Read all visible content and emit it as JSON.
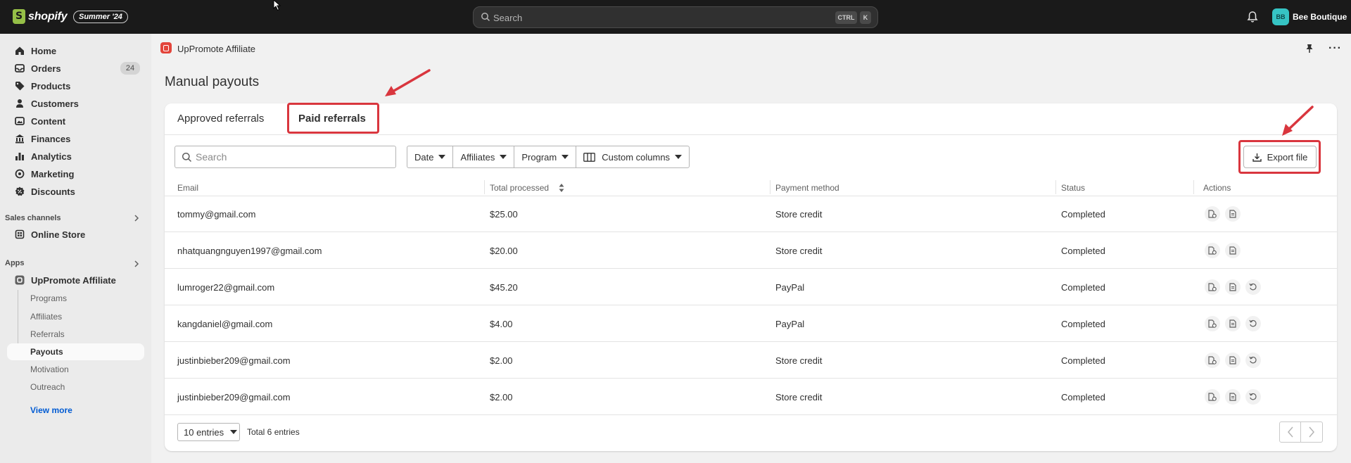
{
  "topbar": {
    "logo_text": "shopify",
    "edition": "Summer '24",
    "search_placeholder": "Search",
    "kbd_ctrl": "CTRL",
    "kbd_k": "K",
    "avatar_initials": "BB",
    "store_name": "Bee Boutique"
  },
  "sidebar": {
    "items": [
      {
        "label": "Home",
        "icon": "home-icon"
      },
      {
        "label": "Orders",
        "icon": "inbox-icon",
        "badge": "24"
      },
      {
        "label": "Products",
        "icon": "tag-icon"
      },
      {
        "label": "Customers",
        "icon": "person-icon"
      },
      {
        "label": "Content",
        "icon": "image-icon"
      },
      {
        "label": "Finances",
        "icon": "bank-icon"
      },
      {
        "label": "Analytics",
        "icon": "bar-chart-icon"
      },
      {
        "label": "Marketing",
        "icon": "target-icon"
      },
      {
        "label": "Discounts",
        "icon": "discount-icon"
      }
    ],
    "sales_channels_title": "Sales channels",
    "online_store": "Online Store",
    "apps_title": "Apps",
    "app_name": "UpPromote Affiliate",
    "app_sub_items": [
      "Programs",
      "Affiliates",
      "Referrals",
      "Payouts",
      "Motivation",
      "Outreach"
    ],
    "active_sub_item": "Payouts",
    "view_more": "View more"
  },
  "app_header": {
    "title": "UpPromote Affiliate",
    "more": "···"
  },
  "page": {
    "title": "Manual payouts",
    "tabs": [
      {
        "label": "Approved referrals",
        "active": false
      },
      {
        "label": "Paid referrals",
        "active": true
      }
    ],
    "search_placeholder": "Search",
    "filters": [
      "Date",
      "Affiliates",
      "Program",
      "Custom columns"
    ],
    "export_label": "Export file",
    "columns": [
      "Email",
      "Total processed",
      "Payment method",
      "Status",
      "Actions"
    ],
    "rows": [
      {
        "email": "tommy@gmail.com",
        "total": "$25.00",
        "method": "Store credit",
        "status": "Completed",
        "actions": [
          "invoice-icon",
          "document-icon"
        ]
      },
      {
        "email": "nhatquangnguyen1997@gmail.com",
        "total": "$20.00",
        "method": "Store credit",
        "status": "Completed",
        "actions": [
          "invoice-icon",
          "document-icon"
        ]
      },
      {
        "email": "lumroger22@gmail.com",
        "total": "$45.20",
        "method": "PayPal",
        "status": "Completed",
        "actions": [
          "invoice-icon",
          "document-icon",
          "undo-icon"
        ]
      },
      {
        "email": "kangdaniel@gmail.com",
        "total": "$4.00",
        "method": "PayPal",
        "status": "Completed",
        "actions": [
          "invoice-icon",
          "document-icon",
          "undo-icon"
        ]
      },
      {
        "email": "justinbieber209@gmail.com",
        "total": "$2.00",
        "method": "Store credit",
        "status": "Completed",
        "actions": [
          "invoice-icon",
          "document-icon",
          "undo-icon"
        ]
      },
      {
        "email": "justinbieber209@gmail.com",
        "total": "$2.00",
        "method": "Store credit",
        "status": "Completed",
        "actions": [
          "invoice-icon",
          "document-icon",
          "undo-icon"
        ]
      }
    ],
    "entries_select": "10 entries",
    "total_entries": "Total 6 entries"
  },
  "colors": {
    "annotation_red": "#d9363e",
    "accent_link": "#005bd3",
    "topbar": "#1a1a1a"
  }
}
